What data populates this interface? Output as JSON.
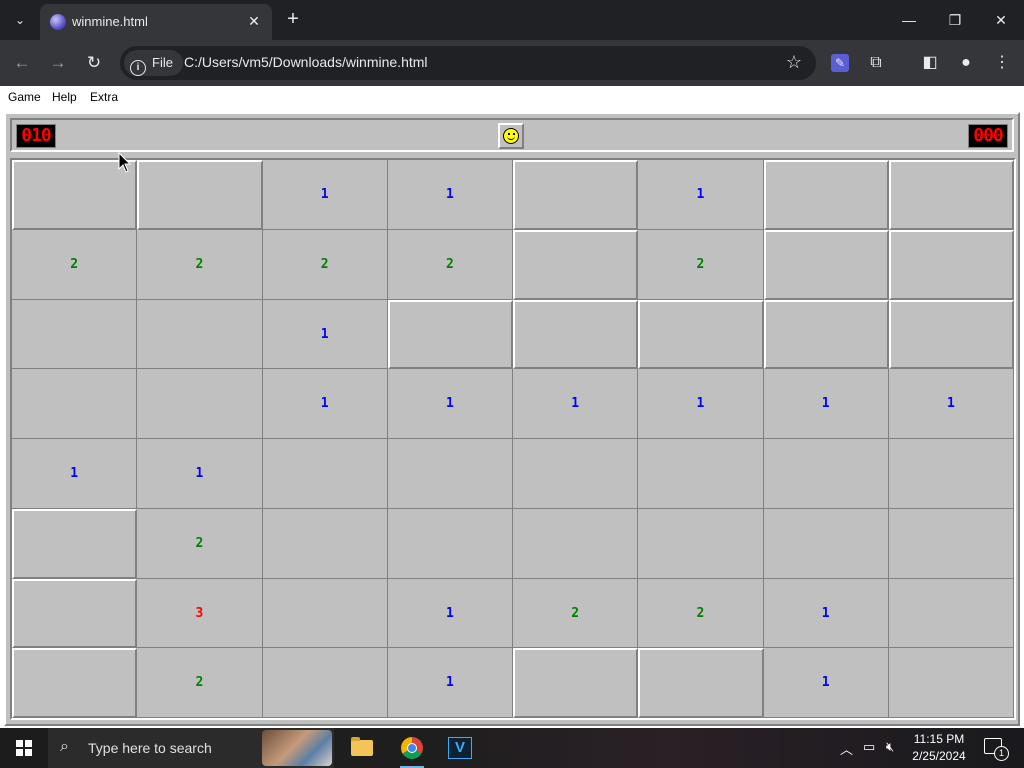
{
  "browser": {
    "tab_title": "winmine.html",
    "tab_close": "✕",
    "new_tab": "+",
    "url_chip": "File",
    "url": "C:/Users/vm5/Downloads/winmine.html",
    "window_controls": {
      "minimize": "—",
      "restore": "❐",
      "close": "✕"
    }
  },
  "menu": {
    "items": [
      "Game",
      "Help",
      "Extra"
    ]
  },
  "game": {
    "mine_counter": "010",
    "timer": "000",
    "face": "smiley",
    "rows": 8,
    "cols": 8,
    "board": [
      [
        "H",
        "H",
        "1",
        "1",
        "H",
        "1",
        "H",
        "H"
      ],
      [
        "2",
        "2",
        "2",
        "2",
        "H",
        "2",
        "H",
        "H"
      ],
      [
        "",
        "",
        "1",
        "H",
        "H",
        "H",
        "H",
        "H"
      ],
      [
        "",
        "",
        "1",
        "1",
        "1",
        "1",
        "1",
        "1"
      ],
      [
        "1",
        "1",
        "",
        "",
        "",
        "",
        "",
        ""
      ],
      [
        "H",
        "2",
        "",
        "",
        "",
        "",
        "",
        ""
      ],
      [
        "H",
        "3",
        "",
        "1",
        "2",
        "2",
        "1",
        ""
      ],
      [
        "H",
        "2",
        "",
        "1",
        "H",
        "H",
        "1",
        ""
      ]
    ],
    "number_colors": {
      "1": "#0000ff",
      "2": "#008000",
      "3": "#ff0000"
    }
  },
  "taskbar": {
    "search_placeholder": "Type here to search",
    "apps": [
      "file-explorer",
      "google-chrome",
      "v-app"
    ],
    "time": "11:15 PM",
    "date": "2/25/2024",
    "notification_count": "1"
  }
}
